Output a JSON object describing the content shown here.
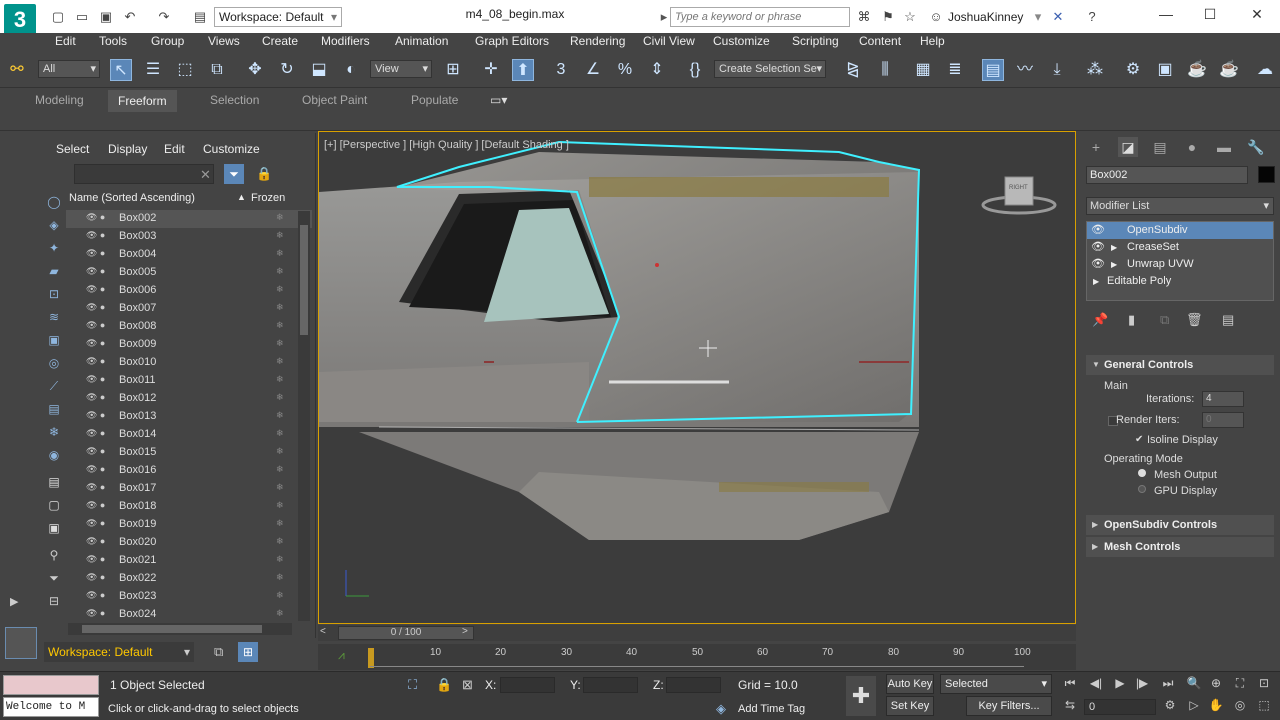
{
  "titlebar": {
    "logo": "3",
    "workspace": "Workspace: Default",
    "document": "m4_08_begin.max",
    "search_placeholder": "Type a keyword or phrase",
    "user": "JoshuaKinney"
  },
  "menus": [
    "Edit",
    "Tools",
    "Group",
    "Views",
    "Create",
    "Modifiers",
    "Animation",
    "Graph Editors",
    "Rendering",
    "Civil View",
    "Customize",
    "Scripting",
    "Content",
    "Help"
  ],
  "toolbar": {
    "filter": "All",
    "ref_coord": "View",
    "selection_set": "Create Selection Se"
  },
  "ribbon_tabs": [
    "Modeling",
    "Freeform",
    "Selection",
    "Object Paint",
    "Populate"
  ],
  "ribbon_active": "Freeform",
  "explorer": {
    "menus": [
      "Select",
      "Display",
      "Edit",
      "Customize"
    ],
    "col_name": "Name (Sorted Ascending)",
    "col_frozen": "Frozen",
    "rows": [
      "Box002",
      "Box003",
      "Box004",
      "Box005",
      "Box006",
      "Box007",
      "Box008",
      "Box009",
      "Box010",
      "Box011",
      "Box012",
      "Box013",
      "Box014",
      "Box015",
      "Box016",
      "Box017",
      "Box018",
      "Box019",
      "Box020",
      "Box021",
      "Box022",
      "Box023",
      "Box024"
    ],
    "workspace": "Workspace: Default"
  },
  "viewport": {
    "label": "[+] [Perspective ] [High Quality ] [Default Shading ]",
    "viewcube": "RIGHT"
  },
  "command_panel": {
    "object_name": "Box002",
    "modifier_list": "Modifier List",
    "stack": [
      "OpenSubdiv",
      "CreaseSet",
      "Unwrap UVW",
      "Editable Poly"
    ],
    "general_controls": "General Controls",
    "main_label": "Main",
    "iterations_label": "Iterations:",
    "iterations_value": "4",
    "render_iters_label": "Render Iters:",
    "render_iters_value": "0",
    "isoline_label": "Isoline Display",
    "operating_mode": "Operating Mode",
    "mesh_output": "Mesh Output",
    "gpu_display": "GPU Display",
    "opensubdiv_controls": "OpenSubdiv Controls",
    "mesh_controls": "Mesh Controls"
  },
  "timeline": {
    "slider_label": "0 / 100",
    "ticks": [
      "10",
      "20",
      "30",
      "40",
      "50",
      "60",
      "70",
      "80",
      "90",
      "100"
    ]
  },
  "status": {
    "maxscript": "Welcome to M",
    "selected": "1 Object Selected",
    "prompt": "Click or click-and-drag to select objects",
    "x_label": "X:",
    "y_label": "Y:",
    "z_label": "Z:",
    "grid": "Grid = 10.0",
    "add_time_tag": "Add Time Tag",
    "auto_key": "Auto Key",
    "set_key": "Set Key",
    "key_mode": "Selected",
    "key_filters": "Key Filters...",
    "frame": "0"
  }
}
